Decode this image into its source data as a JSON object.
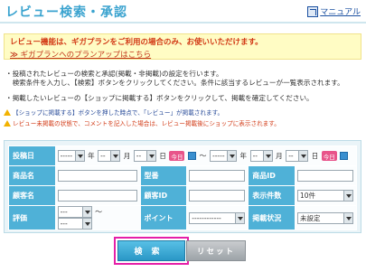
{
  "header": {
    "title": "レビュー検索・承認",
    "manual_label": "マニュアル"
  },
  "notice": {
    "line1": "レビュー機能は、ギガプランをご利用の場合のみ、お使いいただけます。",
    "link_arrow": "≫",
    "link_text": "ギガプランへのプランアップはこちら"
  },
  "description": [
    "・投稿されたレビューの検索と承認(掲載・非掲載)の設定を行います。",
    "　検索条件を入力し、【検索】ボタンをクリックしてください。条件に該当するレビューが一覧表示されます。",
    "・掲載したいレビューの【ショップに掲載する】ボタンをクリックして、掲載を確定してください。"
  ],
  "warnings": [
    "【ショップに掲載する】ボタンを押した時点で、「レビュー」が掲載されます。",
    "レビュー未掲載の状態で、コメントを記入した場合は、レビュー掲載後にショップに表示されます。"
  ],
  "search_form": {
    "post_date": {
      "label": "投稿日",
      "year_from": "-----",
      "year_unit": "年",
      "month_from": "--",
      "month_unit": "月",
      "day_from": "--",
      "day_unit": "日",
      "today_label": "今日",
      "tilde": "～",
      "year_to": "-----",
      "month_to": "--",
      "day_to": "--"
    },
    "product_name_label": "商品名",
    "model_label": "型番",
    "product_id_label": "商品ID",
    "customer_name_label": "顧客名",
    "customer_id_label": "顧客ID",
    "display_count": {
      "label": "表示件数",
      "value": "10件"
    },
    "rating": {
      "label": "評価",
      "from": "---",
      "tilde": "～",
      "to": "---"
    },
    "point": {
      "label": "ポイント",
      "value": "------------"
    },
    "publish_status": {
      "label": "掲載状況",
      "value": "未設定"
    }
  },
  "buttons": {
    "search": "検索",
    "reset": "リセット"
  },
  "colors": {
    "title": "#3aa3cf",
    "label_bg": "#4fb1d7",
    "notice_bg": "#fffcc4",
    "notice_text": "#d23a16",
    "highlight": "#e51fa8"
  }
}
